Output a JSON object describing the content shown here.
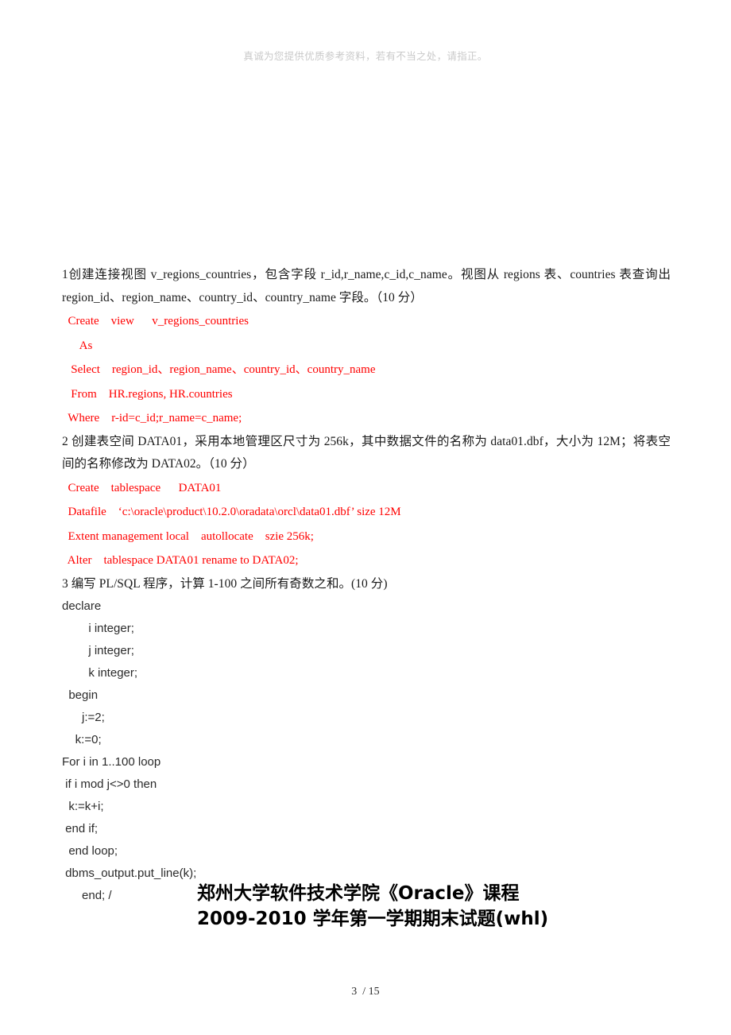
{
  "header": {
    "watermark": "真诚为您提供优质参考资料，若有不当之处，请指正。"
  },
  "questions": [
    {
      "id": "q1",
      "text": "1创建连接视图 v_regions_countries，包含字段 r_id,r_name,c_id,c_name。视图从 regions 表、countries 表查询出 region_id、region_name、country_id、country_name 字段。（10 分）",
      "answer_lines": [
        "  Create    view      v_regions_countries",
        "      As",
        "   Select    region_id、region_name、country_id、country_name",
        "   From    HR.regions, HR.countries",
        "  Where    r-id=c_id;r_name=c_name;"
      ]
    },
    {
      "id": "q2",
      "text": "2 创建表空间 DATA01，采用本地管理区尺寸为 256k，其中数据文件的名称为 data01.dbf，大小为 12M；将表空间的名称修改为 DATA02。（10 分）",
      "answer_lines": [
        "  Create    tablespace      DATA01",
        "  Datafile    ‘c:\\oracle\\product\\10.2.0\\oradata\\orcl\\data01.dbf’ size 12M",
        "  Extent management local    autollocate    szie 256k;",
        "  Alter    tablespace DATA01 rename to DATA02;"
      ]
    },
    {
      "id": "q3",
      "text": "3  编写 PL/SQL 程序，计算 1-100 之间所有奇数之和。(10 分)",
      "answer_lines": [
        "declare",
        "        i integer;",
        "        j integer;",
        "        k integer;",
        "  begin",
        "      j:=2;",
        "    k:=0;",
        "For i in 1..100 loop",
        " if i mod j<>0 then",
        "  k:=k+i;",
        " end if;",
        "  end loop;",
        " dbms_output.put_line(k);",
        "      end; /"
      ]
    }
  ],
  "exam_title": {
    "line1": "郑州大学软件技术学院《Oracle》课程",
    "line2": "2009-2010 学年第一学期期末试题(whl)"
  },
  "footer": {
    "page_number": "3  / 15"
  }
}
